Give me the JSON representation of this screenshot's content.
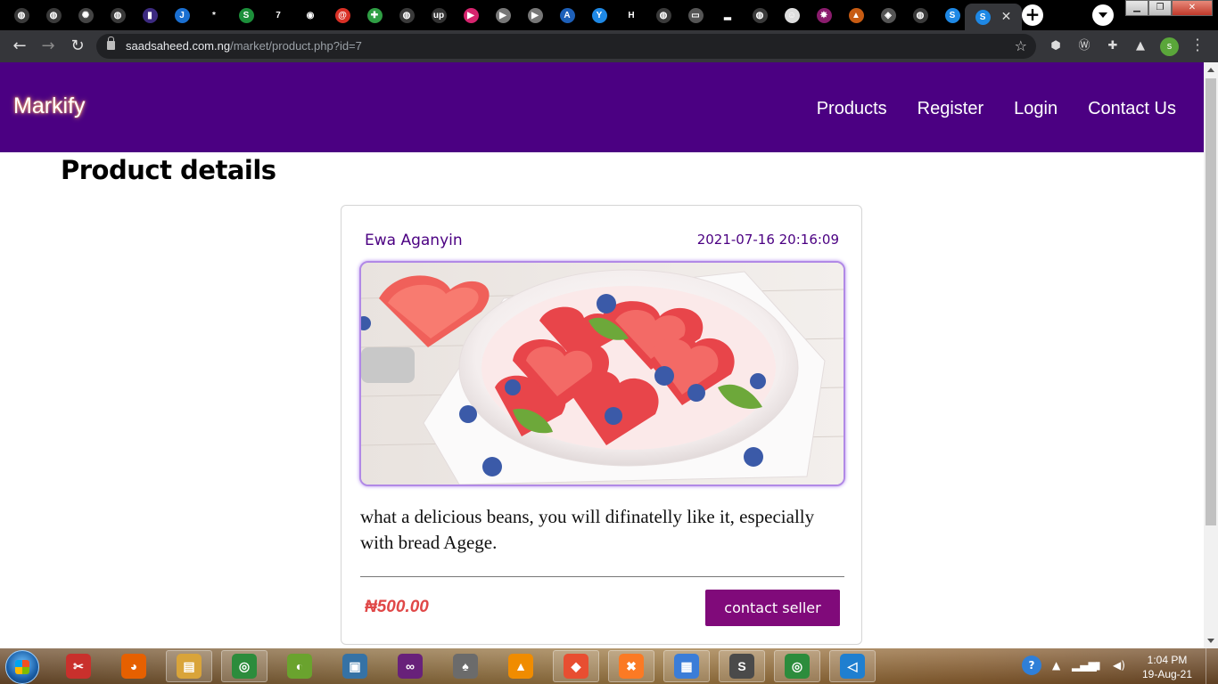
{
  "browser": {
    "tabs": [
      {
        "icon": "globe-icon",
        "color": "#3a3a3a",
        "glyph": "◍"
      },
      {
        "icon": "globe-icon",
        "color": "#3a3a3a",
        "glyph": "◍"
      },
      {
        "icon": "openai-icon",
        "color": "#444",
        "glyph": "✺"
      },
      {
        "icon": "globe-icon",
        "color": "#3a3a3a",
        "glyph": "◍"
      },
      {
        "icon": "book-icon",
        "color": "#3c2a80",
        "glyph": "▮"
      },
      {
        "icon": "bracket-icon",
        "color": "#1a6fd1",
        "glyph": "J"
      },
      {
        "icon": "asterisk-icon",
        "color": "#000",
        "glyph": "*"
      },
      {
        "icon": "s-icon",
        "color": "#1c8f3a",
        "glyph": "S"
      },
      {
        "icon": "seven-icon",
        "color": "#000",
        "glyph": "7"
      },
      {
        "icon": "github-icon",
        "color": "#000",
        "glyph": "◉"
      },
      {
        "icon": "at-icon",
        "color": "#d93025",
        "glyph": "@"
      },
      {
        "icon": "puzzle-icon",
        "color": "#2f9e44",
        "glyph": "✚"
      },
      {
        "icon": "globe-icon",
        "color": "#3a3a3a",
        "glyph": "◍"
      },
      {
        "icon": "upwork-icon",
        "color": "#333",
        "glyph": "up"
      },
      {
        "icon": "play-icon",
        "color": "#d6246e",
        "glyph": "▶"
      },
      {
        "icon": "play-icon",
        "color": "#777",
        "glyph": "▶"
      },
      {
        "icon": "play-icon",
        "color": "#777",
        "glyph": "▶"
      },
      {
        "icon": "angular-icon",
        "color": "#1d5fb8",
        "glyph": "A"
      },
      {
        "icon": "y-icon",
        "color": "#1e88e5",
        "glyph": "Y"
      },
      {
        "icon": "hashnode-icon",
        "color": "#000",
        "glyph": "H"
      },
      {
        "icon": "globe-icon",
        "color": "#3a3a3a",
        "glyph": "◍"
      },
      {
        "icon": "briefcase-icon",
        "color": "#555",
        "glyph": "▭"
      },
      {
        "icon": "bars-icon",
        "color": "#000",
        "glyph": "▂"
      },
      {
        "icon": "globe-icon",
        "color": "#3a3a3a",
        "glyph": "◍"
      },
      {
        "icon": "avatar-icon",
        "color": "#ddd",
        "glyph": "☺"
      },
      {
        "icon": "sparkle-icon",
        "color": "#8a1c6d",
        "glyph": "✸"
      },
      {
        "icon": "pyramid-icon",
        "color": "#c75b12",
        "glyph": "▲"
      },
      {
        "icon": "laravel-icon",
        "color": "#555",
        "glyph": "◈"
      },
      {
        "icon": "globe-icon",
        "color": "#3a3a3a",
        "glyph": "◍"
      },
      {
        "icon": "swiper-icon",
        "color": "#1e88e5",
        "glyph": "S"
      }
    ],
    "active_close": "✕",
    "url_host": "saadsaheed.com.ng",
    "url_path": "/market/product.php?id=7",
    "profile_initial": "s"
  },
  "site": {
    "brand": "Markify",
    "nav": [
      "Products",
      "Register",
      "Login",
      "Contact Us"
    ],
    "page_title": "Product details"
  },
  "product": {
    "seller": "Ewa Aganyin",
    "posted": "2021-07-16 20:16:09",
    "image_alt": "watermelon hearts with blueberries and mint in a white bowl",
    "description": "what a delicious beans, you will difinatelly like it, especially with bread Agege.",
    "price": "₦500.00",
    "contact_label": "contact seller"
  },
  "taskbar": {
    "apps": [
      {
        "icon": "snipping-tool-icon",
        "color": "#c9302c",
        "glyph": "✂"
      },
      {
        "icon": "firefox-icon",
        "color": "#e66000",
        "glyph": "◕"
      },
      {
        "icon": "file-explorer-icon",
        "color": "#d9a43a",
        "glyph": "▤"
      },
      {
        "icon": "chrome-icon",
        "color": "#2c8c3c",
        "glyph": "◎"
      },
      {
        "icon": "eclipse-icon",
        "color": "#6aa32e",
        "glyph": "◐"
      },
      {
        "icon": "virtualbox-icon",
        "color": "#3572a5",
        "glyph": "▣"
      },
      {
        "icon": "visual-studio-icon",
        "color": "#68217a",
        "glyph": "∞"
      },
      {
        "icon": "inkscape-icon",
        "color": "#6b6b6b",
        "glyph": "♠"
      },
      {
        "icon": "vlc-icon",
        "color": "#f08c00",
        "glyph": "▲"
      },
      {
        "icon": "git-icon",
        "color": "#e84e31",
        "glyph": "◆"
      },
      {
        "icon": "xampp-icon",
        "color": "#fb7a24",
        "glyph": "✖"
      },
      {
        "icon": "photos-icon",
        "color": "#3b7dd8",
        "glyph": "▦"
      },
      {
        "icon": "sublime-icon",
        "color": "#4a4a4a",
        "glyph": "S"
      },
      {
        "icon": "chrome-icon",
        "color": "#2c8c3c",
        "glyph": "◎"
      },
      {
        "icon": "vscode-icon",
        "color": "#1f7fd0",
        "glyph": "◁"
      }
    ],
    "time": "1:04 PM",
    "date": "19-Aug-21"
  },
  "colors": {
    "nav_bg": "#4b0082",
    "accent_text": "#4b0082",
    "price": "#e04848",
    "button": "#800a7a"
  }
}
